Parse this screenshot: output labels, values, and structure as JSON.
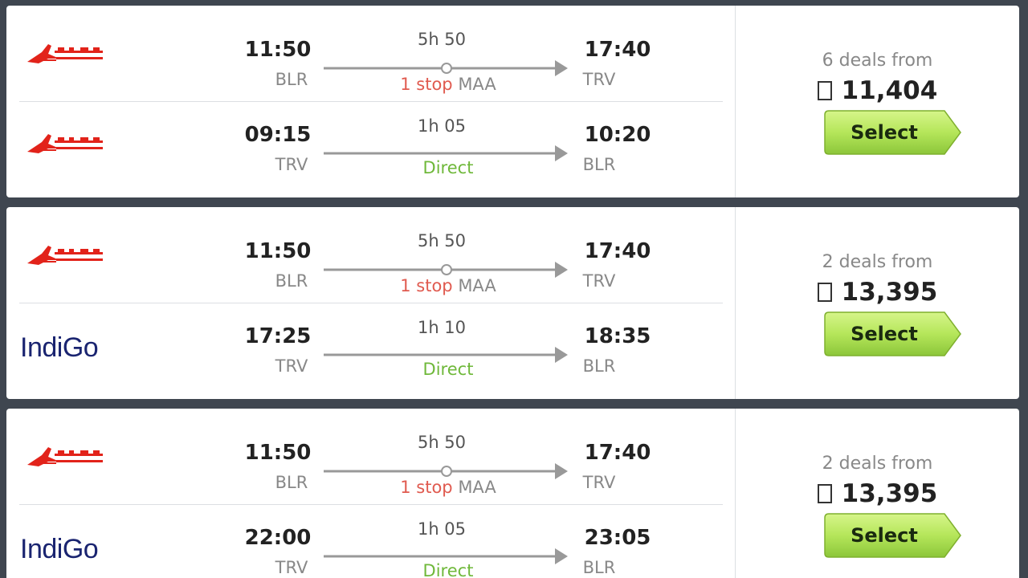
{
  "results": [
    {
      "legs": [
        {
          "airline": "Air India",
          "logo": "air-india-logo",
          "dep_time": "11:50",
          "dep_code": "BLR",
          "duration": "5h 50",
          "stop_count": "1 stop",
          "stop_via": "MAA",
          "direct_label": "",
          "arr_time": "17:40",
          "arr_code": "TRV"
        },
        {
          "airline": "Air India",
          "logo": "air-india-logo",
          "dep_time": "09:15",
          "dep_code": "TRV",
          "duration": "1h 05",
          "stop_count": "",
          "stop_via": "",
          "direct_label": "Direct",
          "arr_time": "10:20",
          "arr_code": "BLR"
        }
      ],
      "deals": "6 deals from",
      "price": "11,404",
      "select_label": "Select"
    },
    {
      "legs": [
        {
          "airline": "Air India",
          "logo": "air-india-logo",
          "dep_time": "11:50",
          "dep_code": "BLR",
          "duration": "5h 50",
          "stop_count": "1 stop",
          "stop_via": "MAA",
          "direct_label": "",
          "arr_time": "17:40",
          "arr_code": "TRV"
        },
        {
          "airline": "IndiGo",
          "logo": "indigo-logo",
          "dep_time": "17:25",
          "dep_code": "TRV",
          "duration": "1h 10",
          "stop_count": "",
          "stop_via": "",
          "direct_label": "Direct",
          "arr_time": "18:35",
          "arr_code": "BLR"
        }
      ],
      "deals": "2 deals from",
      "price": "13,395",
      "select_label": "Select"
    },
    {
      "legs": [
        {
          "airline": "Air India",
          "logo": "air-india-logo",
          "dep_time": "11:50",
          "dep_code": "BLR",
          "duration": "5h 50",
          "stop_count": "1 stop",
          "stop_via": "MAA",
          "direct_label": "",
          "arr_time": "17:40",
          "arr_code": "TRV"
        },
        {
          "airline": "IndiGo",
          "logo": "indigo-logo",
          "dep_time": "22:00",
          "dep_code": "TRV",
          "duration": "1h 05",
          "stop_count": "",
          "stop_via": "",
          "direct_label": "Direct",
          "arr_time": "23:05",
          "arr_code": "BLR"
        }
      ],
      "deals": "2 deals from",
      "price": "13,395",
      "select_label": "Select"
    }
  ],
  "colors": {
    "page_bg": "#3f4650",
    "stop_red": "#e05a4f",
    "direct_green": "#6fb83a",
    "select_green": "#b5e65a",
    "air_india_red": "#e2231a",
    "indigo_blue": "#1a2470"
  }
}
